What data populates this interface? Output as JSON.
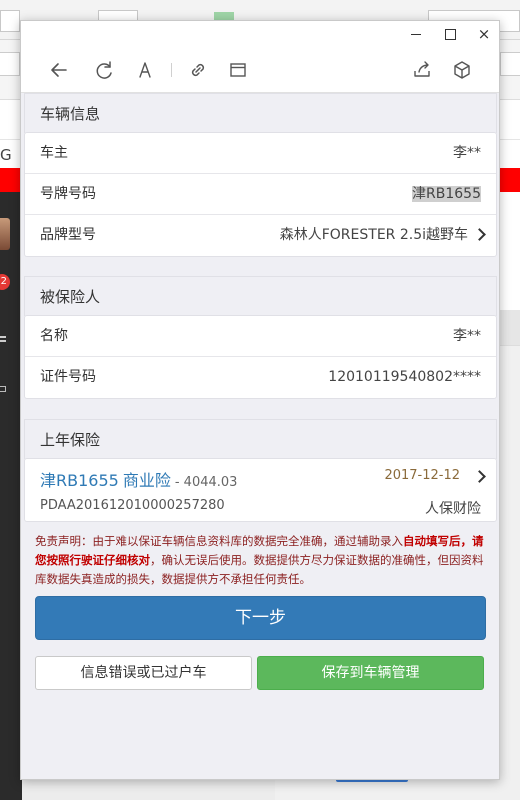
{
  "background": {
    "left_letter": "G",
    "badge_count": "2"
  },
  "window": {
    "controls": {
      "minimize_icon": "minimize-icon",
      "maximize_icon": "maximize-icon",
      "close_glyph": "×"
    }
  },
  "toolbar": {
    "icons": [
      "back-arrow-icon",
      "refresh-icon",
      "font-size-icon",
      "link-icon",
      "window-icon",
      "share-icon",
      "cube-icon"
    ]
  },
  "vehicle": {
    "header": "车辆信息",
    "rows": [
      {
        "label": "车主",
        "value": "李**"
      },
      {
        "label": "号牌号码",
        "value": "津RB1655"
      },
      {
        "label": "品牌型号",
        "value": "森林人FORESTER 2.5i越野车"
      }
    ]
  },
  "insured": {
    "header": "被保险人",
    "rows": [
      {
        "label": "名称",
        "value": "李**"
      },
      {
        "label": "证件号码",
        "value": "12010119540802****"
      }
    ]
  },
  "last_year": {
    "header": "上年保险",
    "plate": "津RB1655",
    "type": "商业险",
    "amount": "- 4044.03",
    "date": "2017-12-12",
    "policy_no": "PDAA201612010000257280",
    "company": "人保财险"
  },
  "disclaimer": {
    "part1": "免责声明：由于难以保证车辆信息资料库的数据完全准确，通过辅助录入",
    "emphasis": "自动填写后，请您按照行驶证仔细核对",
    "part2": "，确认无误后使用。数据提供方尽力保证数据的准确性，但因资料库数据失真造成的损失，数据提供方不承担任何责任。"
  },
  "buttons": {
    "next": "下一步",
    "error": "信息错误或已过户车",
    "save": "保存到车辆管理"
  },
  "colors": {
    "primary": "#337ab7",
    "success": "#5cb85c",
    "link_blue": "#2f7ab5",
    "warning_text": "#8b1f1f",
    "bg_red": "#ff0000"
  }
}
